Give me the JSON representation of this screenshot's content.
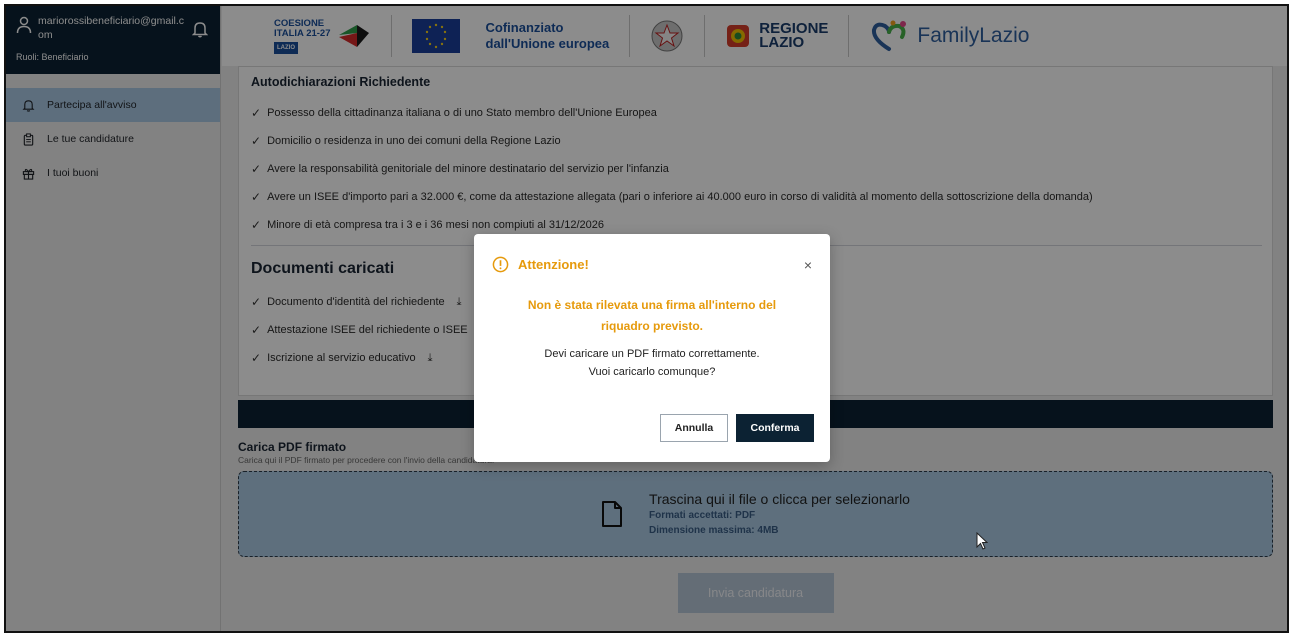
{
  "sidebar": {
    "email": "mariorossibeneficiario@gmail.com",
    "roles": "Ruoli: Beneficiario",
    "items": [
      {
        "label": "Partecipa all'avviso",
        "icon": "bell-icon"
      },
      {
        "label": "Le tue candidature",
        "icon": "clipboard-icon"
      },
      {
        "label": "I tuoi buoni",
        "icon": "gift-icon"
      }
    ]
  },
  "header": {
    "coesione_line1": "COESIONE",
    "coesione_line2": "ITALIA 21-27",
    "coesione_tag": "LAZIO",
    "eu_line1": "Cofinanziato",
    "eu_line2": "dall'Unione europea",
    "regione_line1": "REGIONE",
    "regione_line2": "LAZIO",
    "family": "FamilyLazio"
  },
  "main": {
    "autodichiarazioni_title": "Autodichiarazioni Richiedente",
    "autodichiarazioni": [
      "Possesso della cittadinanza italiana o di uno Stato membro dell'Unione Europea",
      "Domicilio o residenza in uno dei comuni della Regione Lazio",
      "Avere la responsabilità genitoriale del minore destinatario del servizio per l'infanzia",
      "Avere un ISEE d'importo pari a 32.000 €, come da attestazione allegata (pari o inferiore ai 40.000 euro in corso di validità al momento della sottoscrizione della domanda)",
      "Minore di età compresa tra i 3 e i 36 mesi non compiuti al 31/12/2026"
    ],
    "documenti_title": "Documenti caricati",
    "documenti": [
      "Documento d'identità del richiedente",
      "Attestazione ISEE del richiedente o ISEE",
      "Iscrizione al servizio educativo"
    ],
    "upload_title": "Carica PDF firmato",
    "upload_sub": "Carica qui il PDF firmato per procedere con l'invio della candidatura.",
    "dropzone_title": "Trascina qui il file o clicca per selezionarlo",
    "dropzone_formats": "Formati accettati: PDF",
    "dropzone_size": "Dimensione massima: 4MB",
    "submit_label": "Invia candidatura"
  },
  "modal": {
    "title": "Attenzione!",
    "warning_line1": "Non è stata rilevata una firma all'interno del",
    "warning_line2": "riquadro previsto.",
    "message_line1": "Devi caricare un PDF firmato correttamente.",
    "message_line2": "Vuoi caricarlo comunque?",
    "cancel_label": "Annulla",
    "confirm_label": "Conferma",
    "close_symbol": "×"
  },
  "colors": {
    "navy": "#0c2233",
    "accent_blue": "#abcbe4",
    "warning": "#e69a0c"
  }
}
